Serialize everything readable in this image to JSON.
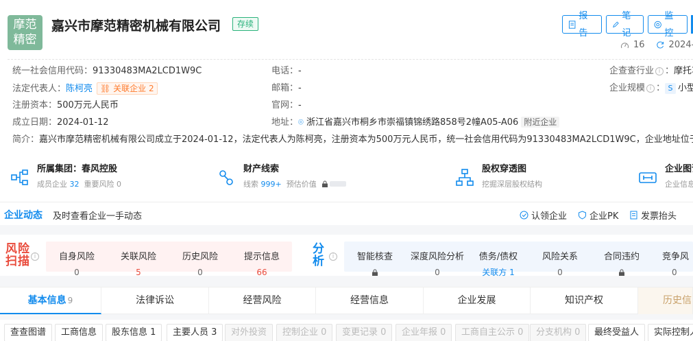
{
  "company": {
    "logo_line1": "摩范",
    "logo_line2": "精密",
    "name": "嘉兴市摩范精密机械有限公司",
    "status": "存续"
  },
  "actions": {
    "report": "报告",
    "note": "笔记",
    "monitor": "监控"
  },
  "meta": {
    "views": "16",
    "updated": "2024-0"
  },
  "info": {
    "credit_code_label": "统一社会信用代码：",
    "credit_code": "91330483MA2LCD1W9C",
    "legal_rep_label": "法定代表人：",
    "legal_rep": "陈柯亮",
    "related_label": "关联企业",
    "related_count": "2",
    "capital_label": "注册资本：",
    "capital": "500万元人民币",
    "founded_label": "成立日期：",
    "founded": "2024-01-12",
    "phone_label": "电话：",
    "phone": "-",
    "email_label": "邮箱：",
    "email": "-",
    "website_label": "官网：",
    "website": "-",
    "address_label": "地址：",
    "address": "浙江省嘉兴市桐乡市崇福镇锦绣路858号2幢A05-A06",
    "nearby": "附近企业",
    "industry_label": "企查查行业",
    "industry": "摩托车",
    "scale_label": "企业规模",
    "scale_badge": "S",
    "scale": "小型",
    "intro_label": "简介：",
    "intro": "嘉兴市摩范精密机械有限公司成立于2024-01-12，法定代表人为陈柯亮，注册资本为500万元人民币，统一社会信用代码为91330483MA2LCD1W9C，企业地址位于浙..."
  },
  "quick": {
    "group_title": "所属集团：春风控股",
    "group_members_label": "成员企业",
    "group_members": "32",
    "group_risk_label": "重要风险",
    "group_risk": "0",
    "assets_title": "财产线索",
    "assets_clues_label": "线索",
    "assets_clues": "999+",
    "assets_value_label": "预估价值",
    "equity_title": "股权穿透图",
    "equity_sub": "挖掘深层股权结构",
    "graph_title": "企业图谱",
    "graph_sub": "企业信息"
  },
  "dynamics": {
    "title": "企业动态",
    "subtitle": "及时查看企业一手动态",
    "claim": "认领企业",
    "pk": "企业PK",
    "invoice": "发票抬头"
  },
  "risk": {
    "label": "风险扫描",
    "items": [
      {
        "label": "自身风险",
        "value": "0"
      },
      {
        "label": "关联风险",
        "value": "5"
      },
      {
        "label": "历史风险",
        "value": "0"
      },
      {
        "label": "提示信息",
        "value": "66"
      }
    ]
  },
  "analysis": {
    "label": "分析",
    "items": [
      {
        "label": "智能核查",
        "value": ""
      },
      {
        "label": "深度风险分析",
        "value": "0"
      },
      {
        "label": "债务/债权",
        "value": "关联方 1"
      },
      {
        "label": "风险关系",
        "value": "0"
      },
      {
        "label": "合同违约",
        "value": ""
      },
      {
        "label": "竞争风",
        "value": "0"
      }
    ]
  },
  "tabs": [
    {
      "label": "基本信息",
      "count": "9"
    },
    {
      "label": "法律诉讼",
      "count": ""
    },
    {
      "label": "经营风险",
      "count": ""
    },
    {
      "label": "经营信息",
      "count": ""
    },
    {
      "label": "企业发展",
      "count": ""
    },
    {
      "label": "知识产权",
      "count": ""
    },
    {
      "label": "历史信",
      "count": ""
    }
  ],
  "subtabs": [
    {
      "label": "查查图谱"
    },
    {
      "label": "工商信息"
    },
    {
      "label": "股东信息 1"
    },
    {
      "label": "主要人员 3"
    },
    {
      "label": "对外投资"
    },
    {
      "label": "控制企业 0"
    },
    {
      "label": "变更记录 0"
    },
    {
      "label": "企业年报 0"
    },
    {
      "label": "工商自主公示 0"
    },
    {
      "label": "分支机构 0"
    },
    {
      "label": "最终受益人"
    },
    {
      "label": "实际控制人"
    }
  ],
  "colors": {
    "brand": "#128bed",
    "risk_red": "#e94c3d",
    "status_green": "#2ab27b",
    "logo_green": "#7fb99a"
  }
}
